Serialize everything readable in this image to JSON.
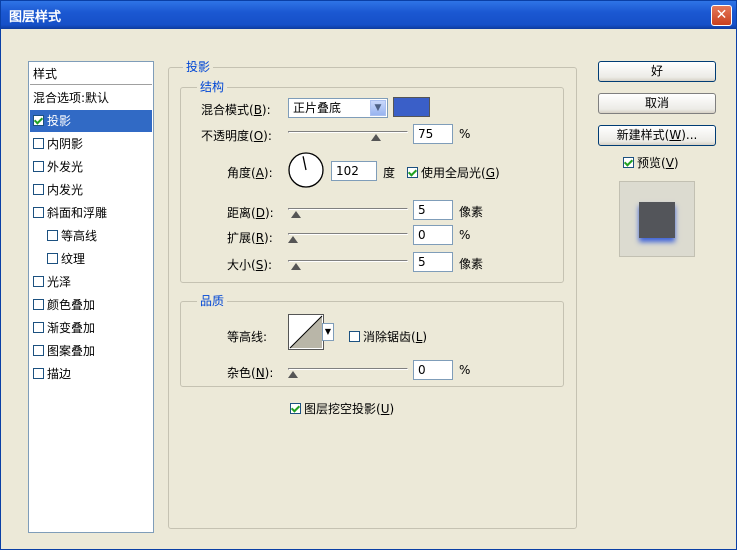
{
  "window": {
    "title": "图层样式",
    "close": "✕"
  },
  "style_list": {
    "header": "样式",
    "items": [
      {
        "label": "混合选项:默认",
        "checkbox": false,
        "checked": false,
        "selected": false,
        "indent": 0
      },
      {
        "label": "投影",
        "checkbox": true,
        "checked": true,
        "selected": true,
        "indent": 0
      },
      {
        "label": "内阴影",
        "checkbox": true,
        "checked": false,
        "selected": false,
        "indent": 0
      },
      {
        "label": "外发光",
        "checkbox": true,
        "checked": false,
        "selected": false,
        "indent": 0
      },
      {
        "label": "内发光",
        "checkbox": true,
        "checked": false,
        "selected": false,
        "indent": 0
      },
      {
        "label": "斜面和浮雕",
        "checkbox": true,
        "checked": false,
        "selected": false,
        "indent": 0
      },
      {
        "label": "等高线",
        "checkbox": true,
        "checked": false,
        "selected": false,
        "indent": 1
      },
      {
        "label": "纹理",
        "checkbox": true,
        "checked": false,
        "selected": false,
        "indent": 1
      },
      {
        "label": "光泽",
        "checkbox": true,
        "checked": false,
        "selected": false,
        "indent": 0
      },
      {
        "label": "颜色叠加",
        "checkbox": true,
        "checked": false,
        "selected": false,
        "indent": 0
      },
      {
        "label": "渐变叠加",
        "checkbox": true,
        "checked": false,
        "selected": false,
        "indent": 0
      },
      {
        "label": "图案叠加",
        "checkbox": true,
        "checked": false,
        "selected": false,
        "indent": 0
      },
      {
        "label": "描边",
        "checkbox": true,
        "checked": false,
        "selected": false,
        "indent": 0
      }
    ]
  },
  "drop_shadow": {
    "title": "投影",
    "structure": {
      "title": "结构",
      "blend_mode": {
        "label_pre": "混合模式(",
        "key": "B",
        "label_post": "):",
        "value": "正片叠底",
        "color": "#3a5fc8"
      },
      "opacity": {
        "label_pre": "不透明度(",
        "key": "O",
        "label_post": "):",
        "value": "75",
        "unit": "%",
        "fraction": 0.75
      },
      "angle": {
        "label_pre": "角度(",
        "key": "A",
        "label_post": "):",
        "value": "102",
        "unit": "度",
        "global_light": {
          "label_pre": "使用全局光(",
          "key": "G",
          "label_post": ")",
          "checked": true
        }
      },
      "distance": {
        "label_pre": "距离(",
        "key": "D",
        "label_post": "):",
        "value": "5",
        "unit": "像素",
        "fraction": 0.03
      },
      "spread": {
        "label_pre": "扩展(",
        "key": "R",
        "label_post": "):",
        "value": "0",
        "unit": "%",
        "fraction": 0
      },
      "size": {
        "label_pre": "大小(",
        "key": "S",
        "label_post": "):",
        "value": "5",
        "unit": "像素",
        "fraction": 0.03
      }
    },
    "quality": {
      "title": "品质",
      "contour": {
        "label": "等高线:"
      },
      "anti_alias": {
        "label_pre": "消除锯齿(",
        "key": "L",
        "label_post": ")",
        "checked": false
      },
      "noise": {
        "label_pre": "杂色(",
        "key": "N",
        "label_post": "):",
        "value": "0",
        "unit": "%",
        "fraction": 0
      }
    },
    "knockout": {
      "label_pre": "图层挖空投影(",
      "key": "U",
      "label_post": ")",
      "checked": true
    }
  },
  "buttons": {
    "ok": "好",
    "cancel": "取消",
    "new_style": {
      "label_pre": "新建样式(",
      "key": "W",
      "label_post": ")..."
    },
    "preview": {
      "label_pre": "预览(",
      "key": "V",
      "label_post": ")",
      "checked": true
    }
  }
}
